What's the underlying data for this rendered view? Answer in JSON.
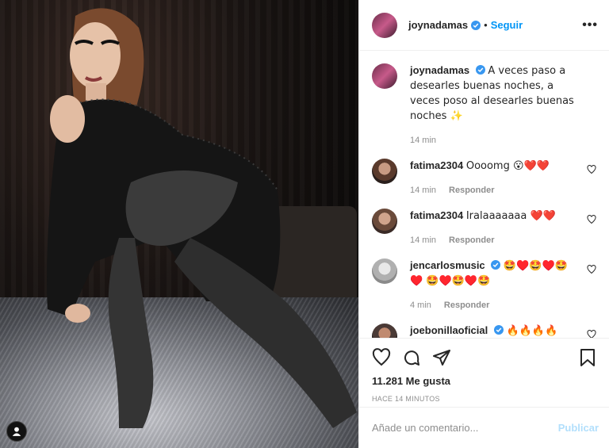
{
  "post": {
    "author": "joynadamas",
    "follow_label": "Seguir",
    "dot": "•",
    "more": "•••"
  },
  "caption": {
    "username": "joynadamas",
    "text": "A veces paso a desearles buenas noches, a veces poso al desearles buenas noches ✨",
    "time": "14 min"
  },
  "comments": [
    {
      "username": "fatima2304",
      "text": "Oooomg 😮❤️❤️",
      "time": "14 min",
      "reply": "Responder"
    },
    {
      "username": "fatima2304",
      "text": "Iralaaaaaaa ❤️❤️",
      "time": "14 min",
      "reply": "Responder"
    },
    {
      "username": "jencarlosmusic",
      "text": "🤩♥️🤩♥️🤩♥️ 🤩♥️🤩♥️🤩",
      "time": "4 min",
      "reply": "Responder"
    },
    {
      "username": "joebonillaoficial",
      "text": "🔥🔥🔥🔥",
      "time": "",
      "reply": ""
    }
  ],
  "stats": {
    "likes": "11.281 Me gusta",
    "posted": "HACE 14 MINUTOS"
  },
  "composer": {
    "placeholder": "Añade un comentario...",
    "publish": "Publicar"
  },
  "icons": {
    "like": "heart-icon",
    "comment": "comment-icon",
    "share": "share-icon",
    "save": "bookmark-icon",
    "verified": "verified-badge-icon",
    "profile": "user-icon"
  },
  "colors": {
    "link": "#0095f6",
    "publish_disabled": "#b2dffc",
    "muted": "#8e8e8e",
    "text": "#262626"
  }
}
